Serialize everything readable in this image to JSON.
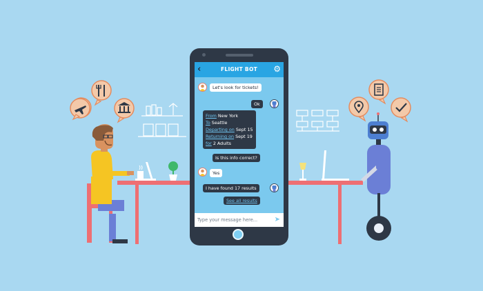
{
  "app": {
    "title": "FLIGHT BOT",
    "back_icon": "back-arrow-icon",
    "settings_icon": "gear-icon"
  },
  "messages": {
    "m1": "Let's look for tickets!",
    "m2": "Ok",
    "summary": {
      "from_label": "From",
      "from_value": " New York",
      "to_label": "To",
      "to_value": " Seattle",
      "dep_label": "Departing on",
      "dep_value": " Sept 15",
      "ret_label": "Returning on",
      "ret_value": " Sept 19",
      "for_label": "for",
      "for_value": " 2 Adults"
    },
    "m4": "Is this info correct?",
    "m5": "Yes",
    "m6": "I have found 17 results",
    "m7": "See all results"
  },
  "input": {
    "placeholder": "Type your message here...",
    "send_icon": "send-icon"
  },
  "colors": {
    "background": "#a9d8f1",
    "phone": "#2e3846",
    "screen": "#7bc9ee",
    "app_bar": "#29a5e3",
    "bubble_dark": "#2e3846",
    "bubble_light": "#ffffff",
    "link": "#6fc4f0",
    "desk": "#ee6f73",
    "shirt": "#f5c523",
    "robot_body": "#6b7fd6"
  },
  "icons": {
    "left_bubbles": [
      "plane-icon",
      "restaurant-icon",
      "bank-icon"
    ],
    "right_bubbles": [
      "map-pin-icon",
      "document-icon",
      "checkmark-icon"
    ]
  }
}
